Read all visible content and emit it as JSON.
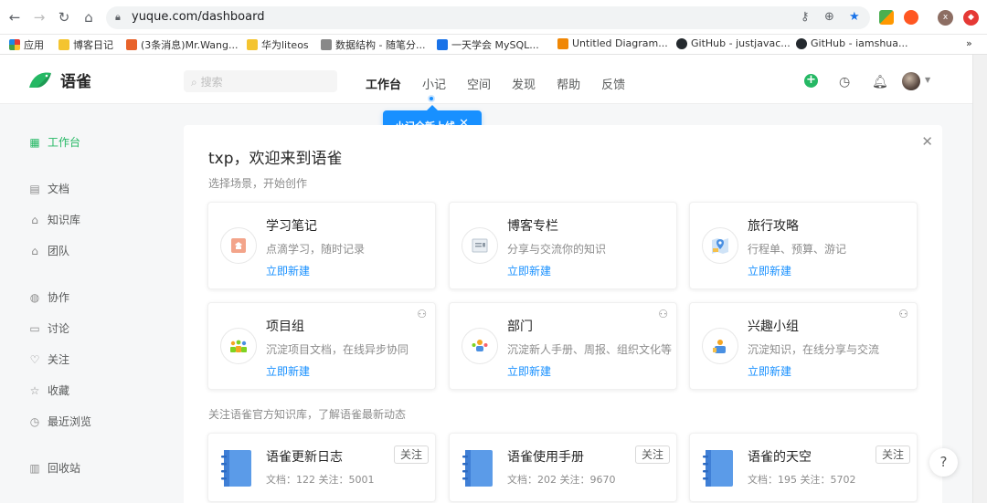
{
  "browser": {
    "url": "yuque.com/dashboard",
    "bookmarks": [
      {
        "label": "应用",
        "color": "#e8453c"
      },
      {
        "label": "博客日记",
        "color": "#f4c430"
      },
      {
        "label": "(3条消息)Mr.Wang...",
        "color": "#e8632b"
      },
      {
        "label": "华为liteos",
        "color": "#f4c430"
      },
      {
        "label": "数据结构 - 随笔分...",
        "color": "#666666"
      },
      {
        "label": "一天学会 MySQL...",
        "color": "#1a73e8"
      },
      {
        "label": "Untitled Diagram...",
        "color": "#f08705"
      },
      {
        "label": "GitHub - justjavac...",
        "color": "#24292e"
      },
      {
        "label": "GitHub - iamshua...",
        "color": "#24292e"
      }
    ],
    "more": "»"
  },
  "header": {
    "logo": "语雀",
    "search_placeholder": "搜索",
    "nav": [
      "工作台",
      "小记",
      "空间",
      "发现",
      "帮助",
      "反馈"
    ],
    "tooltip": "小记全新上线"
  },
  "sidebar": {
    "items": [
      {
        "label": "工作台",
        "icon": "grid-icon",
        "glyph": "▦"
      },
      {
        "label": "文档",
        "icon": "document-icon",
        "glyph": "▤"
      },
      {
        "label": "知识库",
        "icon": "library-icon",
        "glyph": "⌂"
      },
      {
        "label": "团队",
        "icon": "team-icon",
        "glyph": "⌂"
      },
      {
        "label": "协作",
        "icon": "globe-icon",
        "glyph": "◍"
      },
      {
        "label": "讨论",
        "icon": "comment-icon",
        "glyph": "▭"
      },
      {
        "label": "关注",
        "icon": "heart-icon",
        "glyph": "♡"
      },
      {
        "label": "收藏",
        "icon": "star-icon",
        "glyph": "☆"
      },
      {
        "label": "最近浏览",
        "icon": "clock-icon",
        "glyph": "◷"
      },
      {
        "label": "回收站",
        "icon": "trash-icon",
        "glyph": "▥"
      }
    ]
  },
  "main": {
    "welcome": "txp，欢迎来到语雀",
    "subtitle": "选择场景，开始创作",
    "scenes": [
      {
        "title": "学习笔记",
        "desc": "点滴学习，随时记录",
        "link": "立即新建",
        "icon": "study-note-icon"
      },
      {
        "title": "博客专栏",
        "desc": "分享与交流你的知识",
        "link": "立即新建",
        "icon": "blog-icon"
      },
      {
        "title": "旅行攻略",
        "desc": "行程单、预算、游记",
        "link": "立即新建",
        "icon": "map-icon"
      },
      {
        "title": "项目组",
        "desc": "沉淀项目文档，在线异步协同",
        "link": "立即新建",
        "icon": "project-team-icon"
      },
      {
        "title": "部门",
        "desc": "沉淀新人手册、周报、组织文化等",
        "link": "立即新建",
        "icon": "department-icon"
      },
      {
        "title": "兴趣小组",
        "desc": "沉淀知识，在线分享与交流",
        "link": "立即新建",
        "icon": "interest-group-icon"
      }
    ],
    "follow_section": "关注语雀官方知识库，了解语雀最新动态",
    "books": [
      {
        "title": "语雀更新日志",
        "meta": "文档：122   关注：5001",
        "follow": "关注"
      },
      {
        "title": "语雀使用手册",
        "meta": "文档：202   关注：9670",
        "follow": "关注"
      },
      {
        "title": "语雀的天空",
        "meta": "文档：195   关注：5702",
        "follow": "关注"
      }
    ],
    "help": "?"
  },
  "colors": {
    "accent": "#25b864",
    "link": "#1890ff"
  }
}
